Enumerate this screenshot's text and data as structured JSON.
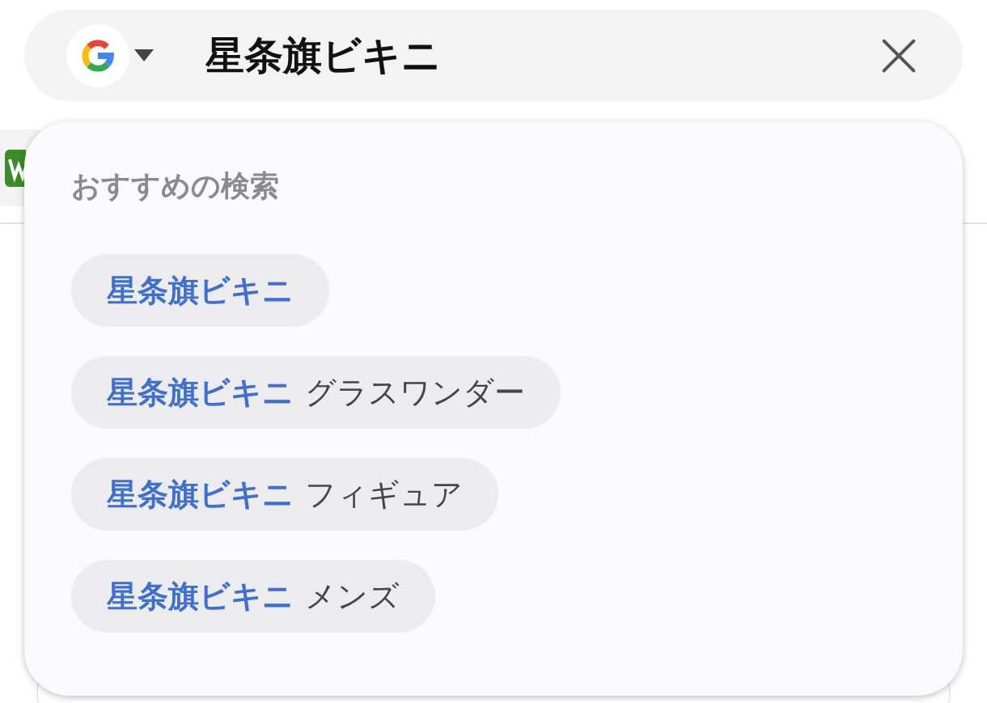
{
  "search": {
    "value": "星条旗ビキニ"
  },
  "suggestions": {
    "heading": "おすすめの検索",
    "items": [
      {
        "match": "星条旗ビキニ"
      },
      {
        "match": "星条旗ビキニ",
        "rest": "グラスワンダー"
      },
      {
        "match": "星条旗ビキニ",
        "rest": "フィギュア"
      },
      {
        "match": "星条旗ビキニ",
        "rest": "メンズ"
      }
    ]
  }
}
